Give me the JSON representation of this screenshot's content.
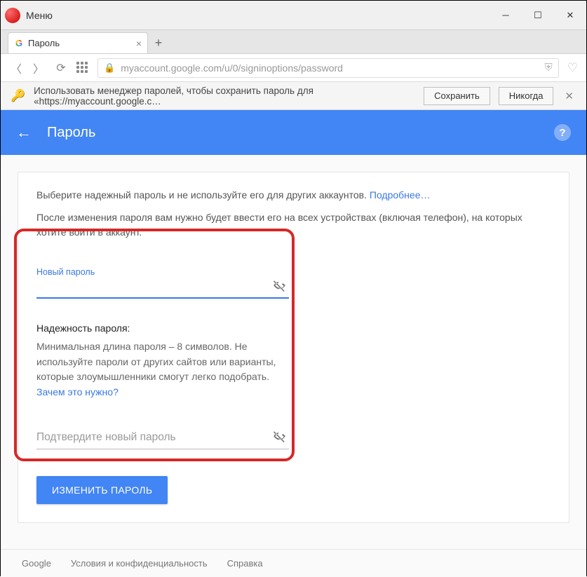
{
  "titlebar": {
    "menu_label": "Меню"
  },
  "tab": {
    "title": "Пароль"
  },
  "address": {
    "url": "myaccount.google.com/u/0/signinoptions/password"
  },
  "pwbar": {
    "text": "Использовать менеджер паролей, чтобы сохранить пароль для «https://myaccount.google.c…",
    "save": "Сохранить",
    "never": "Никогда"
  },
  "header": {
    "title": "Пароль"
  },
  "intro": {
    "line1": "Выберите надежный пароль и не используйте его для других аккаунтов.",
    "more": "Подробнее…",
    "line2": "После изменения пароля вам нужно будет ввести его на всех устройствах (включая телефон), на которых хотите войти в аккаунт."
  },
  "form": {
    "new_label": "Новый пароль",
    "strength_heading": "Надежность пароля:",
    "strength_body": "Минимальная длина пароля – 8 символов. Не используйте пароли от других сайтов или варианты, которые злоумышленники смогут легко подобрать.",
    "why_link": "Зачем это нужно?",
    "confirm_placeholder": "Подтвердите новый пароль",
    "submit": "ИЗМЕНИТЬ ПАРОЛЬ"
  },
  "footer": {
    "brand": "Google",
    "privacy": "Условия и конфиденциальность",
    "help": "Справка"
  }
}
